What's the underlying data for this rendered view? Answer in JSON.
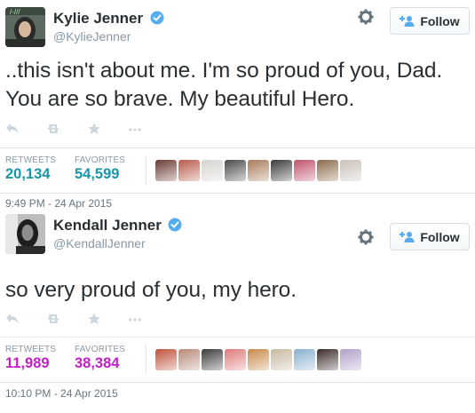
{
  "tweets": [
    {
      "display_name": "Kylie Jenner",
      "handle": "@KylieJenner",
      "follow_label": "Follow",
      "text": "..this isn't about me. I'm so proud of you, Dad. You are so brave. My beautiful Hero.",
      "retweets_label": "RETWEETS",
      "retweets_count": "20,134",
      "favorites_label": "FAVORITES",
      "favorites_count": "54,599",
      "timestamp": "9:49 PM - 24 Apr 2015",
      "count_color": "#1b95a9",
      "face_colors": [
        "#6a3a33",
        "#b85a4a",
        "#d6d3cf",
        "#4a4a4a",
        "#a97a5a",
        "#3a3a3a",
        "#c0506a",
        "#8a6a4a",
        "#c8c0b8"
      ]
    },
    {
      "display_name": "Kendall Jenner",
      "handle": "@KendallJenner",
      "follow_label": "Follow",
      "text": "so very proud of you, my hero.",
      "retweets_label": "RETWEETS",
      "retweets_count": "11,989",
      "favorites_label": "FAVORITES",
      "favorites_count": "38,384",
      "timestamp": "10:10 PM - 24 Apr 2015",
      "count_color": "#c21fc7",
      "face_colors": [
        "#c0503a",
        "#b88a78",
        "#3a3a3a",
        "#e07a7a",
        "#c88a4a",
        "#c8b8a0",
        "#8ab0d0",
        "#3a2a2a",
        "#b0a0c8"
      ]
    }
  ],
  "icons": {
    "verified": "verified-badge-icon",
    "gear": "gear-icon",
    "follow": "add-user-icon",
    "reply": "reply-icon",
    "retweet": "retweet-icon",
    "favorite": "star-icon",
    "more": "more-dots-icon"
  },
  "colors": {
    "verified_blue": "#55acee",
    "follow_blue": "#55acee",
    "action_gray": "#ccd6dd",
    "handle_gray": "#8899a6"
  }
}
